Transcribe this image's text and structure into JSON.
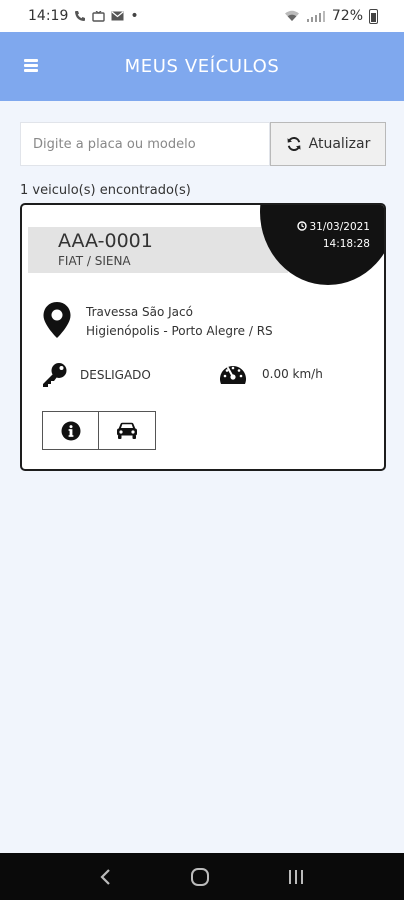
{
  "status_bar": {
    "time": "14:19",
    "battery": "72%",
    "icons": [
      "call-icon",
      "tv-icon",
      "mail-icon",
      "dot-icon",
      "wifi-icon",
      "signal-icon",
      "battery-icon"
    ]
  },
  "header": {
    "title": "MEUS VEÍCULOS",
    "menu_icon": "menu-icon",
    "color": "#7fa8ee"
  },
  "search": {
    "placeholder": "Digite a placa ou modelo",
    "value": "",
    "refresh_label": "Atualizar",
    "refresh_icon": "refresh-icon"
  },
  "results": {
    "count_text": "1 veiculo(s) encontrado(s)"
  },
  "vehicles": [
    {
      "plate": "AAA-0001",
      "model": "FIAT / SIENA",
      "date": "31/03/2021",
      "time": "14:18:28",
      "address_line1": "Travessa São Jacó",
      "address_line2": "Higienópolis - Porto Alegre / RS",
      "ignition": "DESLIGADO",
      "speed": "0.00 km/h",
      "icons": {
        "location": "location-pin-icon",
        "ignition": "key-icon",
        "speed": "speedometer-icon",
        "info": "info-icon",
        "car": "car-icon"
      }
    }
  ],
  "nav_bar": {
    "icons": [
      "back-icon",
      "home-icon",
      "recents-icon"
    ]
  }
}
